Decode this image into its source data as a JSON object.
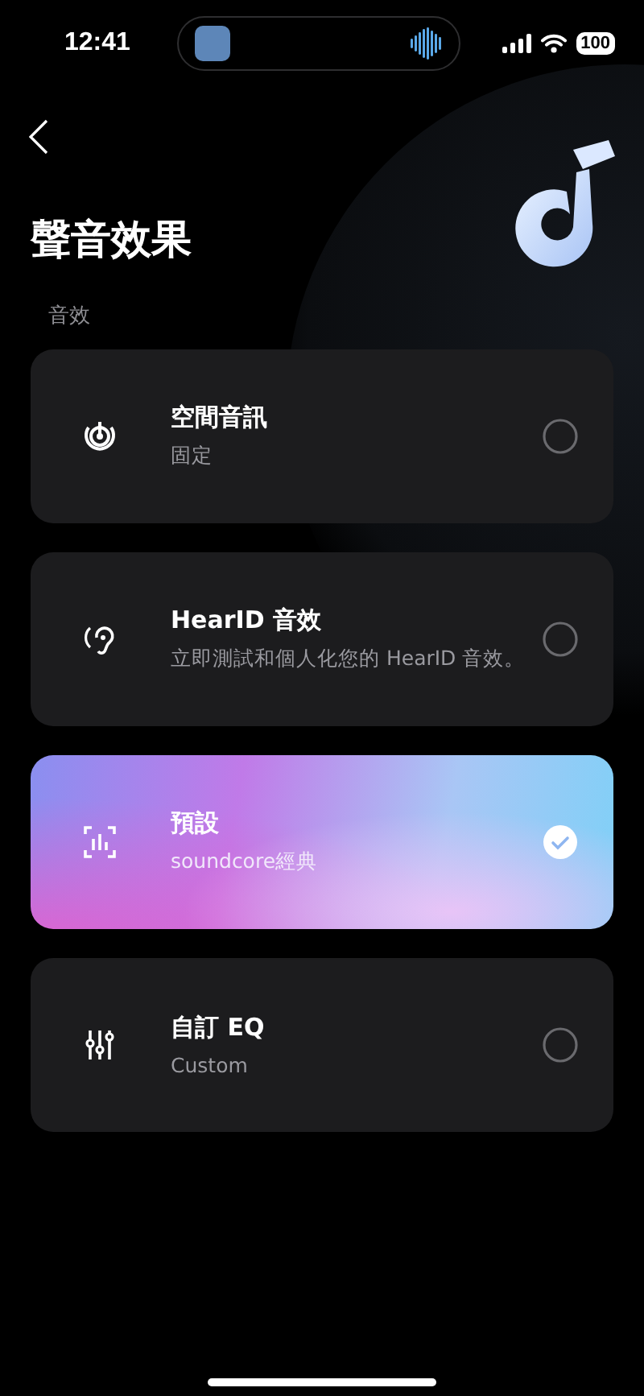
{
  "status_bar": {
    "time": "12:41",
    "battery": "100"
  },
  "header": {
    "title": "聲音效果"
  },
  "section": {
    "label": "音效"
  },
  "options": [
    {
      "kind": "spatial",
      "title": "空間音訊",
      "subtitle": "固定",
      "selected": false
    },
    {
      "kind": "ear",
      "title": "HearID 音效",
      "subtitle": "立即測試和個人化您的 HearID 音效。",
      "selected": false
    },
    {
      "kind": "preset",
      "title": "預設",
      "subtitle": "soundcore經典",
      "selected": true
    },
    {
      "kind": "eq",
      "title": "自訂 EQ",
      "subtitle": "Custom",
      "selected": false
    }
  ]
}
